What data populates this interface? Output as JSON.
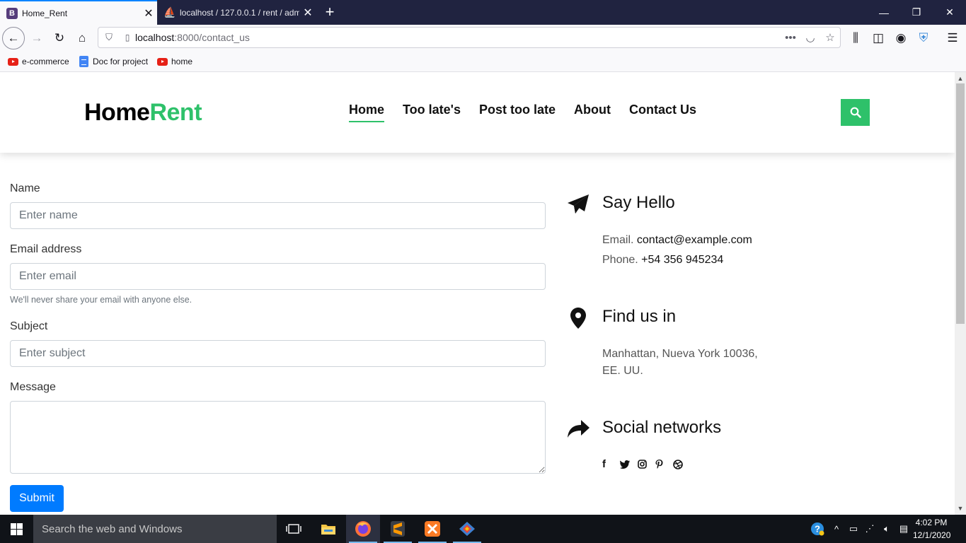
{
  "browser": {
    "tabs": [
      {
        "title": "Home_Rent",
        "favicon": "B"
      },
      {
        "title": "localhost / 127.0.0.1 / rent / adm"
      }
    ],
    "url_host": "localhost",
    "url_path": ":8000/contact_us",
    "bookmarks": [
      {
        "label": "e-commerce",
        "icon": "youtube-icon"
      },
      {
        "label": "Doc for project",
        "icon": "docs-icon"
      },
      {
        "label": "home",
        "icon": "youtube-icon"
      }
    ]
  },
  "site": {
    "logo_part1": "Home",
    "logo_part2": "Rent",
    "logo_colors": {
      "part1": "#000000",
      "part2": "#2ec16a"
    },
    "menu": [
      "Home",
      "Too late's",
      "Post too late",
      "About",
      "Contact Us"
    ],
    "accent": "#2ec16a"
  },
  "form": {
    "name_label": "Name",
    "name_placeholder": "Enter name",
    "email_label": "Email address",
    "email_placeholder": "Enter email",
    "email_hint": "We'll never share your email with anyone else.",
    "subject_label": "Subject",
    "subject_placeholder": "Enter subject",
    "message_label": "Message",
    "submit_label": "Submit",
    "submit_color": "#007bff"
  },
  "contact": {
    "hello_title": "Say Hello",
    "email_prefix": "Email.",
    "email_value": "contact@example.com",
    "phone_prefix": "Phone.",
    "phone_value": "+54 356 945234",
    "find_title": "Find us in",
    "address_line1": "Manhattan, Nueva York 10036,",
    "address_line2": "EE. UU.",
    "social_title": "Social networks",
    "social_icons": [
      "facebook-icon",
      "twitter-icon",
      "instagram-icon",
      "pinterest-icon",
      "dribbble-icon"
    ]
  },
  "taskbar": {
    "search_placeholder": "Search the web and Windows",
    "time": "4:02 PM",
    "date": "12/1/2020"
  }
}
